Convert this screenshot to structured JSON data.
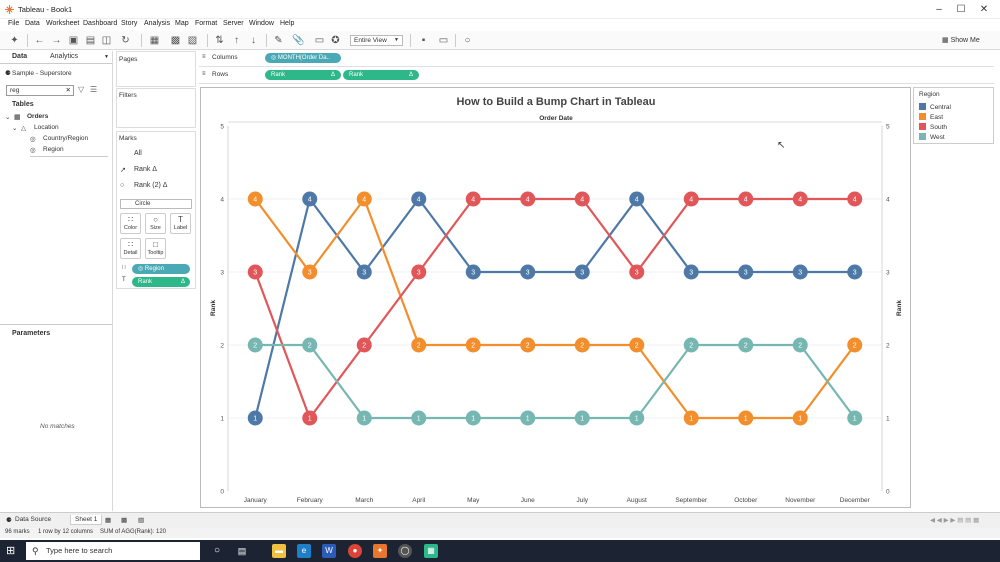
{
  "window": {
    "title": "Tableau - Book1"
  },
  "menu": [
    "File",
    "Data",
    "Worksheet",
    "Dashboard",
    "Story",
    "Analysis",
    "Map",
    "Format",
    "Server",
    "Window",
    "Help"
  ],
  "toolbar": {
    "view_mode": "Entire View",
    "show_me": "Show Me"
  },
  "data_pane": {
    "tabs": [
      "Data",
      "Analytics"
    ],
    "datasource": "Sample - Superstore",
    "search_value": "reg",
    "tables_title": "Tables",
    "tree": [
      "Orders",
      "Location",
      "Country/Region",
      "Region"
    ],
    "parameters_title": "Parameters",
    "no_matches": "No matches"
  },
  "cards": {
    "pages": "Pages",
    "filters": "Filters",
    "marks": "Marks",
    "marks_rows": [
      "All",
      "Rank Δ",
      "Rank (2) Δ"
    ],
    "mark_type": "Circle",
    "props": [
      "Color",
      "Size",
      "Label",
      "Detail",
      "Tooltip"
    ],
    "pills": [
      "Region",
      "Rank"
    ],
    "pill_delta": "Δ"
  },
  "shelves": {
    "columns_label": "Columns",
    "rows_label": "Rows",
    "columns_pill": "MONTH(Order Da..",
    "rows_pills": [
      "Rank",
      "Rank"
    ],
    "delta": "Δ"
  },
  "legend": {
    "title": "Region",
    "items": [
      {
        "name": "Central",
        "color": "#4e79a7"
      },
      {
        "name": "East",
        "color": "#f28e2b"
      },
      {
        "name": "South",
        "color": "#e15759"
      },
      {
        "name": "West",
        "color": "#76b7b2"
      }
    ]
  },
  "chart_data": {
    "type": "line",
    "title": "How to Build a Bump Chart in Tableau",
    "top_axis_title": "Order Date",
    "ylabel": "Rank",
    "ylabel_right": "Rank",
    "ylim": [
      0,
      5
    ],
    "yticks": [
      0,
      1,
      2,
      3,
      4,
      5
    ],
    "categories": [
      "January",
      "February",
      "March",
      "April",
      "May",
      "June",
      "July",
      "August",
      "September",
      "October",
      "November",
      "December"
    ],
    "series": [
      {
        "name": "Central",
        "color": "#4e79a7",
        "values": [
          1,
          4,
          3,
          4,
          3,
          3,
          3,
          4,
          3,
          3,
          3,
          3
        ]
      },
      {
        "name": "East",
        "color": "#f28e2b",
        "values": [
          4,
          3,
          4,
          2,
          2,
          2,
          2,
          2,
          1,
          1,
          1,
          2
        ]
      },
      {
        "name": "South",
        "color": "#e15759",
        "values": [
          3,
          1,
          2,
          3,
          4,
          4,
          4,
          3,
          4,
          4,
          4,
          4
        ]
      },
      {
        "name": "West",
        "color": "#76b7b2",
        "values": [
          2,
          2,
          1,
          1,
          1,
          1,
          1,
          1,
          2,
          2,
          2,
          1
        ]
      }
    ]
  },
  "sheet_tabs": {
    "data_source": "Data Source",
    "sheet": "Sheet 1"
  },
  "status": {
    "marks": "96 marks",
    "layout": "1 row by 12 columns",
    "sum": "SUM of AGG(Rank): 120"
  },
  "taskbar": {
    "search_placeholder": "Type here to search"
  }
}
